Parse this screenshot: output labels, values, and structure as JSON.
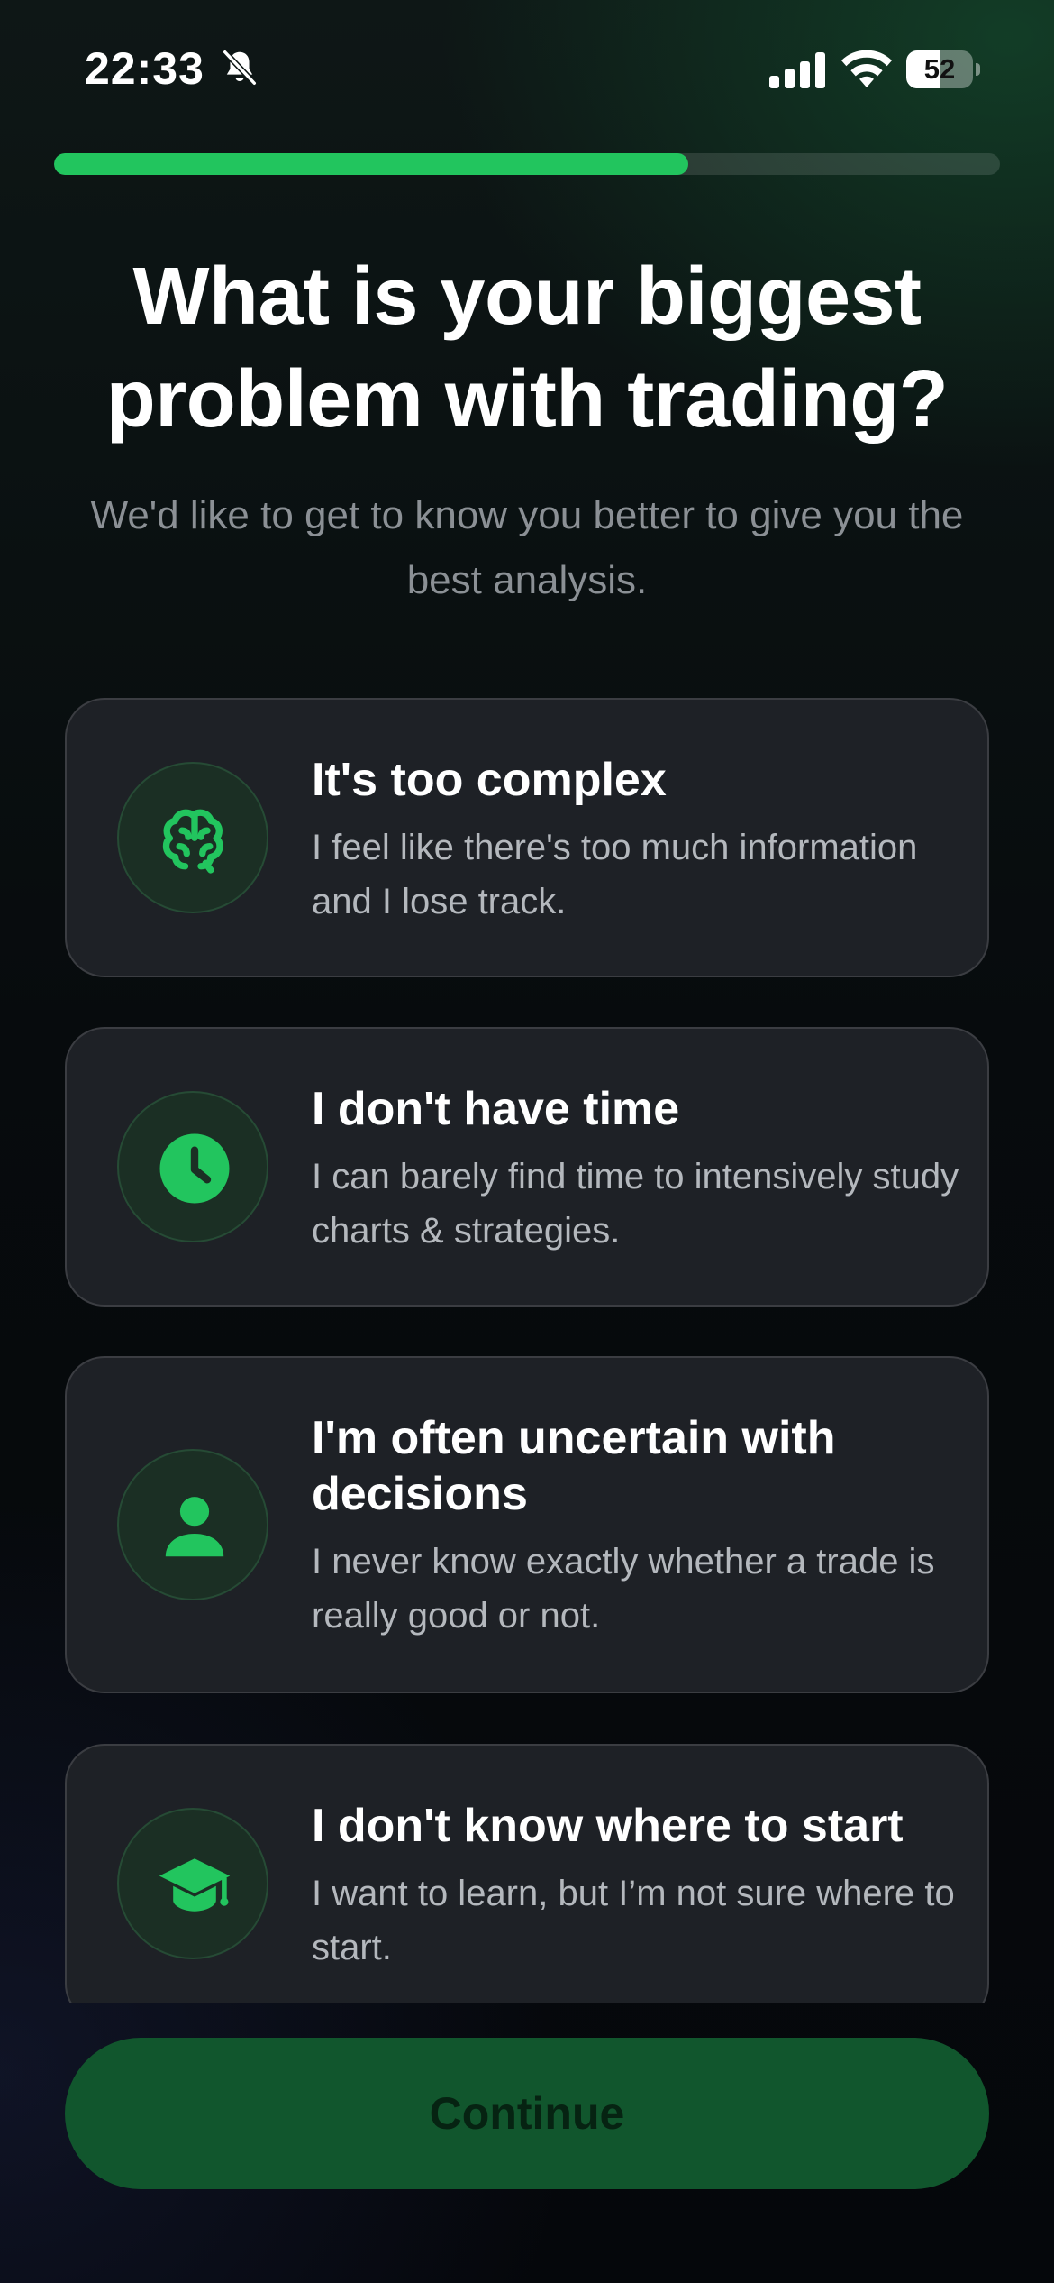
{
  "status_bar": {
    "time": "22:33",
    "battery_level": "52",
    "battery_fraction": 0.52
  },
  "progress": {
    "fraction": 0.67
  },
  "header": {
    "title": "What is your biggest problem with trading?",
    "subtitle": "We'd like to get to know you better to give you the best analysis."
  },
  "options": [
    {
      "icon": "brain-icon",
      "title": "It's too complex",
      "description": "I feel like there's too much information and I lose track."
    },
    {
      "icon": "clock-icon",
      "title": "I don't have time",
      "description": "I can barely find time to intensively study charts & strategies."
    },
    {
      "icon": "user-icon",
      "title": "I'm often uncertain with decisions",
      "description": "I never know exactly whether a trade is really good or not."
    },
    {
      "icon": "graduation-cap-icon",
      "title": "I don't know where to start",
      "description": "I want to learn, but I’m not sure where to start."
    }
  ],
  "footer": {
    "continue_label": "Continue"
  },
  "colors": {
    "accent": "#22c55e",
    "card_background": "#1e2126",
    "button_disabled": "#11562d"
  }
}
